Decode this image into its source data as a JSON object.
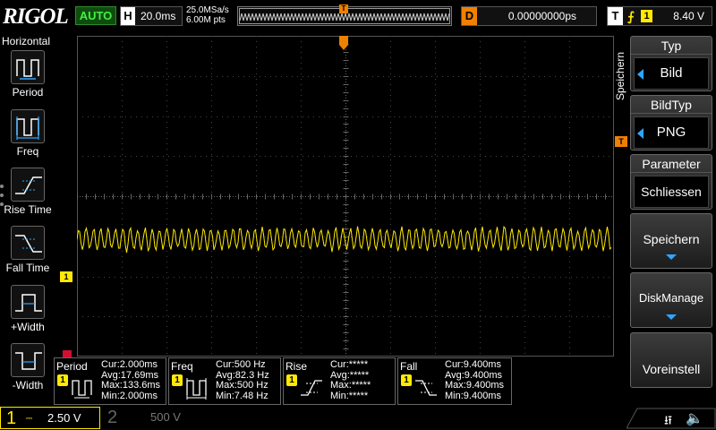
{
  "brand": "RIGOL",
  "run_state": "AUTO",
  "horizontal": {
    "label": "H",
    "timebase": "20.0ms"
  },
  "acquisition": {
    "sample_rate": "25.0MSa/s",
    "memory_depth": "6.00M pts"
  },
  "delay": {
    "label": "D",
    "value": "0.00000000ps"
  },
  "trigger": {
    "label": "T",
    "edge_symbol": "⨍",
    "source": "1",
    "level": "8.40 V",
    "pos_marker": "T",
    "level_marker": "T"
  },
  "left_menu": {
    "title": "Horizontal",
    "items": [
      {
        "label": "Period",
        "icon": "period-icon"
      },
      {
        "label": "Freq",
        "icon": "freq-icon"
      },
      {
        "label": "Rise Time",
        "icon": "rise-time-icon"
      },
      {
        "label": "Fall Time",
        "icon": "fall-time-icon"
      },
      {
        "label": "+Width",
        "icon": "positive-width-icon"
      },
      {
        "label": "-Width",
        "icon": "negative-width-icon"
      }
    ]
  },
  "channel1_marker": "1",
  "right_menu": {
    "title": "Speichern",
    "type": {
      "label": "Typ",
      "value": "Bild"
    },
    "image_type": {
      "label": "BildTyp",
      "value": "PNG"
    },
    "parameter": {
      "label": "Parameter",
      "value": "Schliessen"
    },
    "save": "Speichern",
    "disk_manage": "DiskManage",
    "defaults": "Voreinstell"
  },
  "measurements": [
    {
      "name": "Period",
      "channel": "1",
      "cur": "Cur:2.000ms",
      "avg": "Avg:17.69ms",
      "max": "Max:133.6ms",
      "min": "Min:2.000ms"
    },
    {
      "name": "Freq",
      "channel": "1",
      "cur": "Cur:500 Hz",
      "avg": "Avg:82.3 Hz",
      "max": "Max:500 Hz",
      "min": "Min:7.48 Hz"
    },
    {
      "name": "Rise",
      "channel": "1",
      "cur": "Cur:*****",
      "avg": "Avg:*****",
      "max": "Max:*****",
      "min": "Min:*****"
    },
    {
      "name": "Fall",
      "channel": "1",
      "cur": "Cur:9.400ms",
      "avg": "Avg:9.400ms",
      "max": "Max:9.400ms",
      "min": "Min:9.400ms"
    }
  ],
  "channels": [
    {
      "number": "1",
      "coupling": "⎓",
      "scale": "2.50 V",
      "color": "#ffea00"
    },
    {
      "number": "2",
      "scale": "500 V",
      "color": "#666666"
    }
  ],
  "colors": {
    "trace": "#ffea00",
    "trigger": "#f08000",
    "accent": "#2ea6ff"
  }
}
